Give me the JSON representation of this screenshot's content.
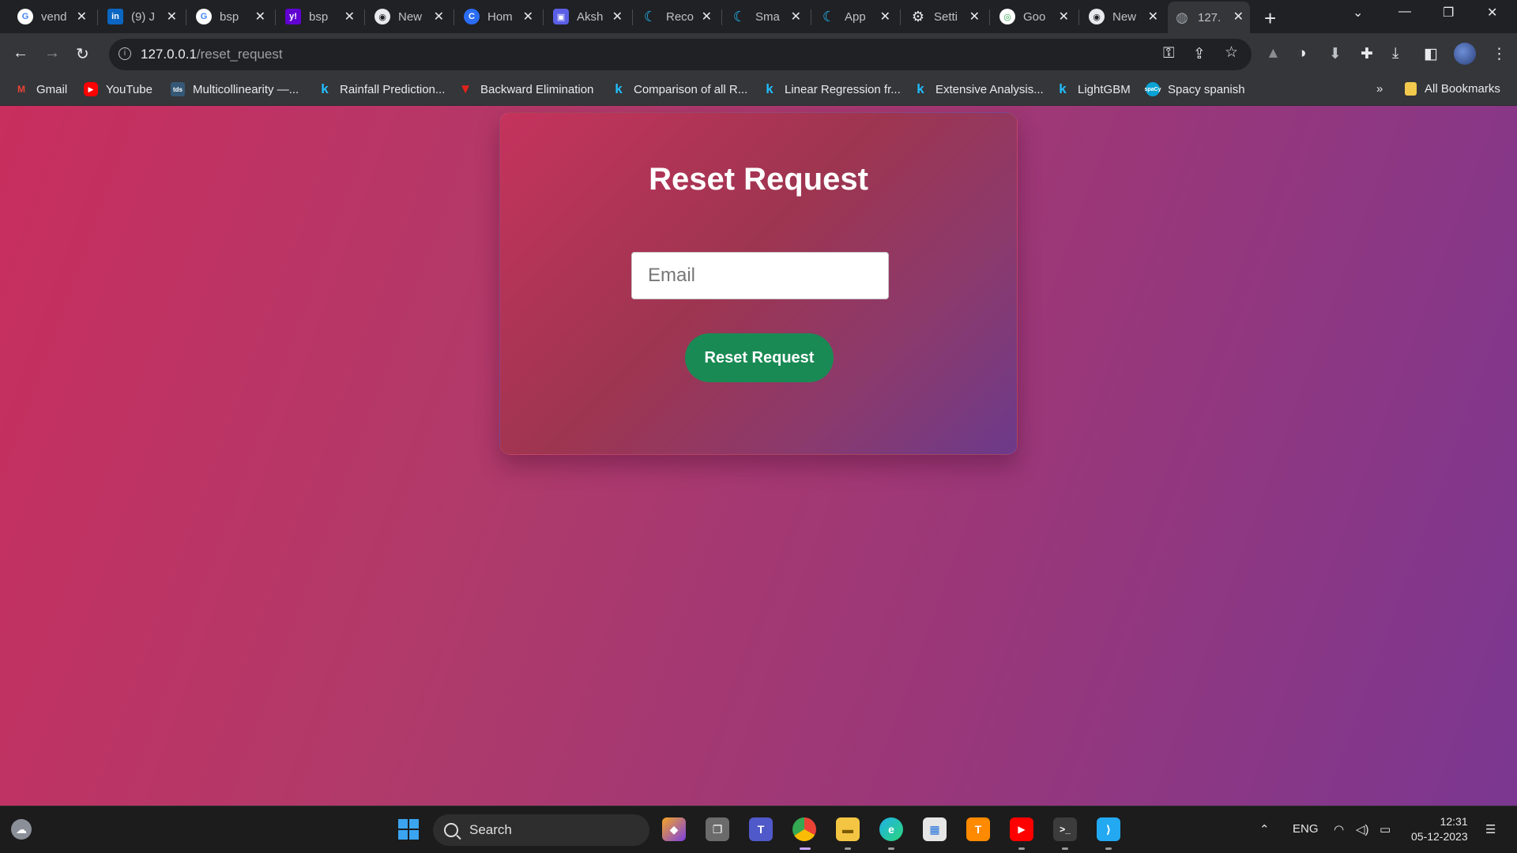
{
  "browser": {
    "tabs": [
      {
        "title": "vend",
        "icon": "google-icon",
        "color": "#4285f4"
      },
      {
        "title": "(9) J",
        "icon": "linkedin-icon",
        "color": "#0a66c2"
      },
      {
        "title": "bsp",
        "icon": "google-icon",
        "color": "#4285f4"
      },
      {
        "title": "bsp",
        "icon": "yahoo-icon",
        "color": "#6001d2"
      },
      {
        "title": "New",
        "icon": "chrome-icon",
        "color": "#5f6368"
      },
      {
        "title": "Hom",
        "icon": "copilot-icon",
        "color": "#2a6df4"
      },
      {
        "title": "Aksh",
        "icon": "app-icon",
        "color": "#5b5fe6"
      },
      {
        "title": "Reco",
        "icon": "kaggle-icon",
        "color": "#20beff"
      },
      {
        "title": "Sma",
        "icon": "kaggle-icon",
        "color": "#20beff"
      },
      {
        "title": "App",
        "icon": "kaggle-icon",
        "color": "#20beff"
      },
      {
        "title": "Setti",
        "icon": "gear-icon",
        "color": "#5f6368"
      },
      {
        "title": "Goo",
        "icon": "google-lens-icon",
        "color": "#34a853"
      },
      {
        "title": "New",
        "icon": "chrome-icon",
        "color": "#5f6368"
      },
      {
        "title": "127.",
        "icon": "globe-icon",
        "color": "#5f6368"
      }
    ],
    "url_host": "127.0.0.1",
    "url_path": "/reset_request"
  },
  "bookmarks": [
    {
      "label": "Gmail",
      "icon": "gmail-icon",
      "color": "#ea4335"
    },
    {
      "label": "YouTube",
      "icon": "youtube-icon",
      "color": "#ff0000"
    },
    {
      "label": "Multicollinearity —...",
      "icon": "tds-icon",
      "color": "#355876"
    },
    {
      "label": "Rainfall Prediction...",
      "icon": "kaggle-icon",
      "color": "#20beff"
    },
    {
      "label": "Backward Elimination",
      "icon": "vee-icon",
      "color": "#e2231a"
    },
    {
      "label": "Comparison of all R...",
      "icon": "kaggle-icon",
      "color": "#20beff"
    },
    {
      "label": "Linear Regression fr...",
      "icon": "kaggle-icon",
      "color": "#20beff"
    },
    {
      "label": "Extensive Analysis...",
      "icon": "kaggle-icon",
      "color": "#20beff"
    },
    {
      "label": "LightGBM",
      "icon": "kaggle-icon",
      "color": "#20beff"
    },
    {
      "label": "Spacy spanish",
      "icon": "spacy-icon",
      "color": "#09a3d5"
    }
  ],
  "bookmarks_all": "All Bookmarks",
  "page": {
    "title": "Reset Request",
    "email_placeholder": "Email",
    "button_label": "Reset Request"
  },
  "taskbar": {
    "search_label": "Search",
    "lang": "ENG",
    "time": "12:31",
    "date": "05-12-2023"
  }
}
